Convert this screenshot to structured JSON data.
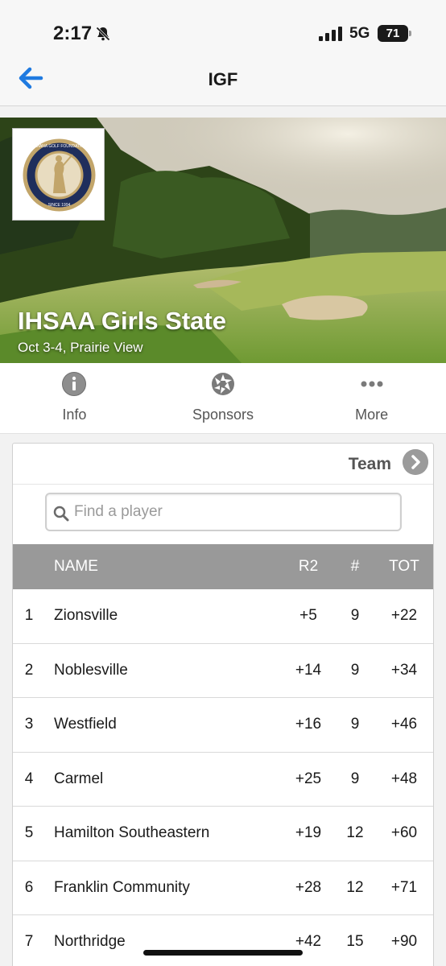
{
  "status_bar": {
    "time": "2:17",
    "network": "5G",
    "battery": "71"
  },
  "nav": {
    "title": "IGF"
  },
  "event": {
    "title": "IHSAA Girls State",
    "subtitle": "Oct 3-4, Prairie View"
  },
  "logo": {
    "ring_text": "INDIANA GOLF FOUNDATION",
    "since": "SINCE 1994"
  },
  "tabs": [
    {
      "label": "Info",
      "icon": "info-icon"
    },
    {
      "label": "Sponsors",
      "icon": "aperture-icon"
    },
    {
      "label": "More",
      "icon": "ellipsis-icon"
    }
  ],
  "leaderboard": {
    "view_toggle": "Team",
    "search_placeholder": "Find a player",
    "columns": {
      "pos": "",
      "name": "NAME",
      "r2": "R2",
      "holes": "#",
      "tot": "TOT"
    },
    "rows": [
      {
        "pos": "1",
        "name": "Zionsville",
        "r2": "+5",
        "holes": "9",
        "tot": "+22"
      },
      {
        "pos": "2",
        "name": "Noblesville",
        "r2": "+14",
        "holes": "9",
        "tot": "+34"
      },
      {
        "pos": "3",
        "name": "Westfield",
        "r2": "+16",
        "holes": "9",
        "tot": "+46"
      },
      {
        "pos": "4",
        "name": "Carmel",
        "r2": "+25",
        "holes": "9",
        "tot": "+48"
      },
      {
        "pos": "5",
        "name": "Hamilton Southeastern",
        "r2": "+19",
        "holes": "12",
        "tot": "+60"
      },
      {
        "pos": "6",
        "name": "Franklin Community",
        "r2": "+28",
        "holes": "12",
        "tot": "+71"
      },
      {
        "pos": "7",
        "name": "Northridge",
        "r2": "+42",
        "holes": "15",
        "tot": "+90"
      }
    ]
  },
  "colors": {
    "accent": "#1f7ae0",
    "header_gray": "#999999",
    "logo_navy": "#1f2e5c",
    "logo_gold": "#c2a56a"
  }
}
